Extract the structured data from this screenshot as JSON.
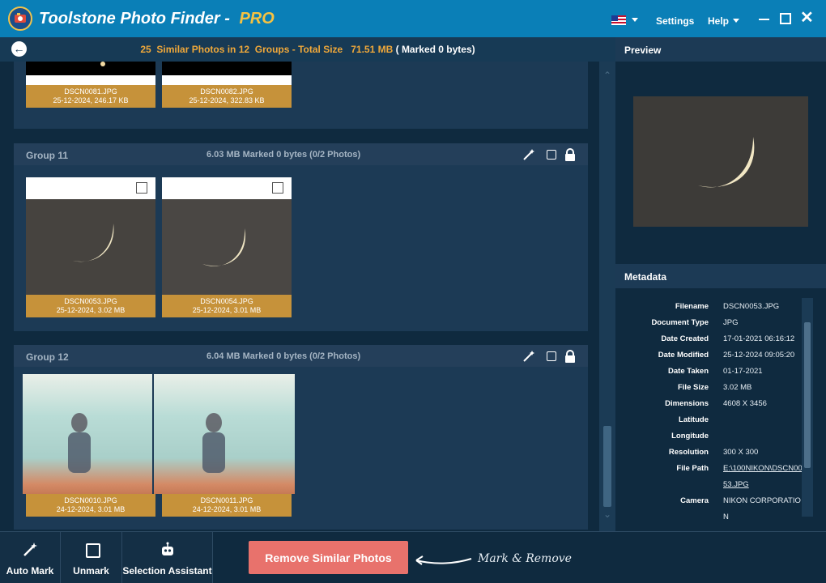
{
  "app": {
    "title": "Toolstone Photo Finder - ",
    "edition": "PRO"
  },
  "menu": {
    "settings": "Settings",
    "help": "Help"
  },
  "summary": {
    "count": "25",
    "label_similar": "Similar Photos in",
    "groups": "12",
    "label_groups": "Groups - Total Size",
    "size": "71.51 MB",
    "marked": "( Marked 0 bytes)"
  },
  "groups": [
    {
      "name": "",
      "info": "",
      "photos": [
        {
          "name": "DSCN0081.JPG",
          "meta": "25-12-2024, 246.17 KB"
        },
        {
          "name": "DSCN0082.JPG",
          "meta": "25-12-2024, 322.83 KB"
        }
      ]
    },
    {
      "name": "Group 11",
      "info": "6.03 MB Marked 0 bytes (0/2 Photos)",
      "photos": [
        {
          "name": "DSCN0053.JPG",
          "meta": "25-12-2024, 3.02 MB"
        },
        {
          "name": "DSCN0054.JPG",
          "meta": "25-12-2024, 3.01 MB"
        }
      ]
    },
    {
      "name": "Group 12",
      "info": "6.04 MB Marked 0 bytes (0/2 Photos)",
      "photos": [
        {
          "name": "DSCN0010.JPG",
          "meta": "24-12-2024, 3.01 MB"
        },
        {
          "name": "DSCN0011.JPG",
          "meta": "24-12-2024, 3.01 MB"
        }
      ]
    }
  ],
  "preview": {
    "title": "Preview"
  },
  "metadata": {
    "title": "Metadata",
    "rows": [
      {
        "key": "Filename",
        "value": "DSCN0053.JPG"
      },
      {
        "key": "Document Type",
        "value": "JPG"
      },
      {
        "key": "Date Created",
        "value": "17-01-2021 06:16:12"
      },
      {
        "key": "Date Modified",
        "value": "25-12-2024 09:05:20"
      },
      {
        "key": "Date Taken",
        "value": "01-17-2021"
      },
      {
        "key": "File Size",
        "value": "3.02 MB"
      },
      {
        "key": "Dimensions",
        "value": "4608 X 3456"
      },
      {
        "key": "Latitude",
        "value": ""
      },
      {
        "key": "Longitude",
        "value": ""
      },
      {
        "key": "Resolution",
        "value": "300 X 300"
      },
      {
        "key": "File Path",
        "value": "E:\\100NIKON\\DSCN00",
        "value2": "53.JPG"
      },
      {
        "key": "Camera",
        "value": "NIKON CORPORATIO",
        "value2": "N"
      }
    ]
  },
  "bottom": {
    "auto_mark": "Auto Mark",
    "unmark": "Unmark",
    "selection_assistant": "Selection Assistant",
    "remove": "Remove Similar Photos",
    "hint": "Mark & Remove"
  }
}
